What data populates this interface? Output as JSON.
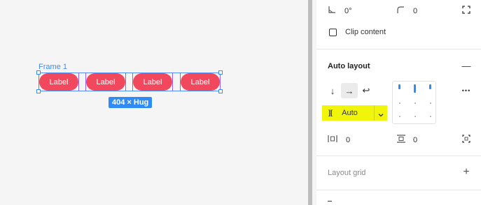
{
  "canvas": {
    "frame_label": "Frame 1",
    "items": [
      "Label",
      "Label",
      "Label",
      "Label"
    ],
    "size_badge": "404 × Hug"
  },
  "panel": {
    "rotation": "0°",
    "corner_radius": "0",
    "clip_content_label": "Clip content",
    "auto_layout": {
      "title": "Auto layout",
      "collapse_symbol": "—",
      "direction_down": "↓",
      "direction_right": "→",
      "direction_wrap": "↩",
      "spacing_icon": "]|[",
      "spacing_value": "Auto",
      "more": "•••",
      "padding_horizontal": "0",
      "padding_vertical": "0"
    },
    "layout_grid": {
      "title": "Layout grid",
      "add": "+"
    }
  },
  "colors": {
    "pill": "#f2485e",
    "selection": "#3d8cf5",
    "highlight": "#f0f50a"
  }
}
